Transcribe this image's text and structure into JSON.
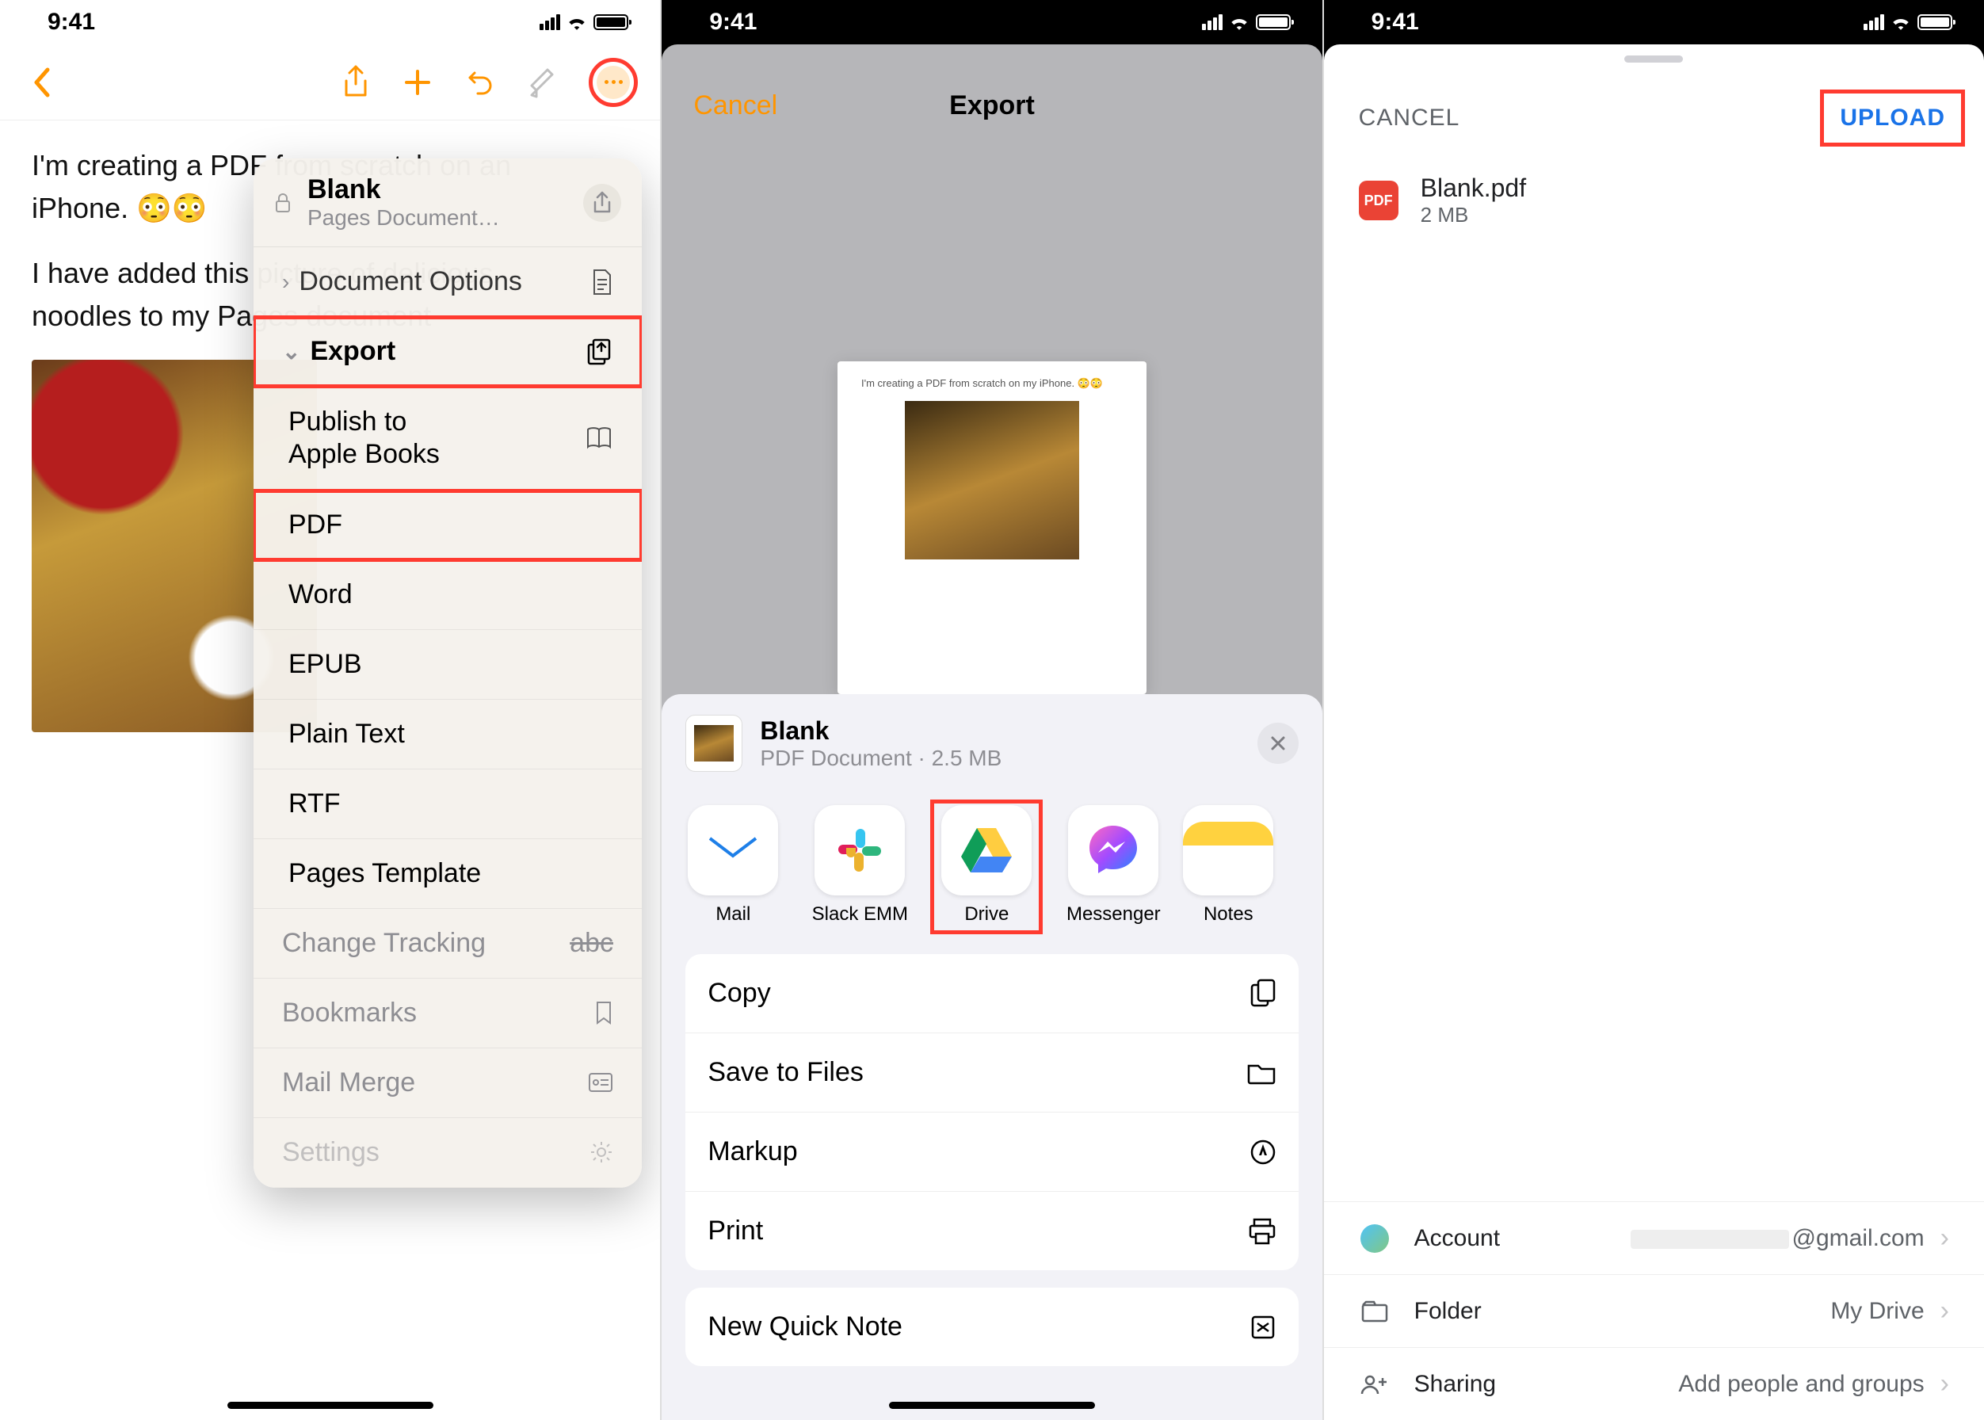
{
  "status": {
    "time": "9:41"
  },
  "panel1": {
    "body_lines": [
      "I'm creating a PDF from scratch on an",
      "iPhone. 😳😳",
      "",
      "I have added this picture of delicious",
      "noodles to my Pages document"
    ],
    "dropdown": {
      "doc_title": "Blank",
      "doc_subtitle": "Pages Document…",
      "doc_options": "Document Options",
      "export": "Export",
      "publish": "Publish to\nApple Books",
      "pdf": "PDF",
      "word": "Word",
      "epub": "EPUB",
      "plain_text": "Plain Text",
      "rtf": "RTF",
      "pages_template": "Pages Template",
      "change_tracking": "Change Tracking",
      "change_tracking_val": "abc",
      "bookmarks": "Bookmarks",
      "mail_merge": "Mail Merge",
      "settings": "Settings"
    }
  },
  "panel2": {
    "cancel": "Cancel",
    "title": "Export",
    "preview_text": "I'm creating a PDF from scratch on my iPhone. 😳😳",
    "share": {
      "file_name": "Blank",
      "file_meta": "PDF Document · 2.5 MB",
      "apps": {
        "mail": "Mail",
        "slack": "Slack EMM",
        "drive": "Drive",
        "messenger": "Messenger",
        "notes": "Notes"
      },
      "actions": {
        "copy": "Copy",
        "save_files": "Save to Files",
        "markup": "Markup",
        "print": "Print",
        "quick_note": "New Quick Note"
      }
    }
  },
  "panel3": {
    "cancel": "CANCEL",
    "upload": "UPLOAD",
    "file_name": "Blank.pdf",
    "file_size": "2 MB",
    "pdf_badge": "PDF",
    "rows": {
      "account": {
        "label": "Account",
        "value": "@gmail.com"
      },
      "folder": {
        "label": "Folder",
        "value": "My Drive"
      },
      "sharing": {
        "label": "Sharing",
        "value": "Add people and groups"
      }
    }
  }
}
